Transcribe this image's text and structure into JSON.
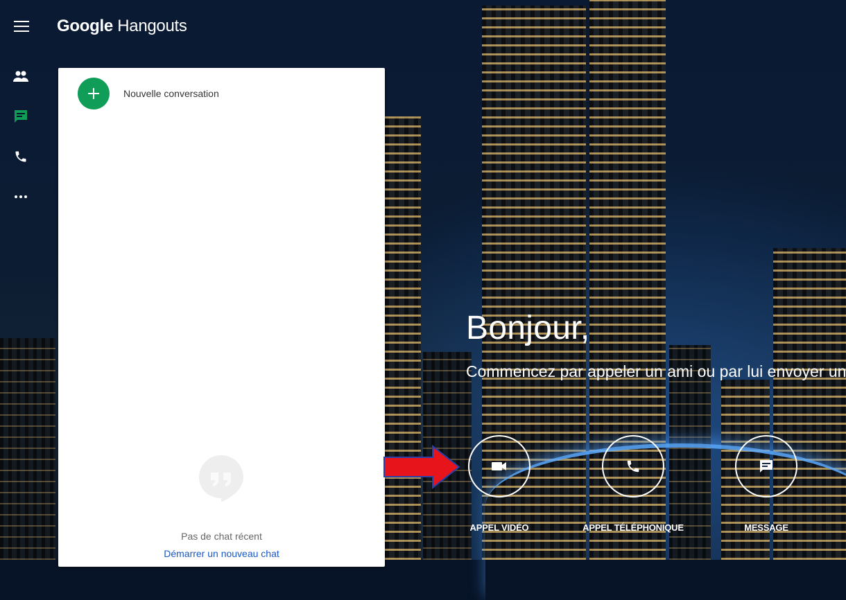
{
  "app": {
    "brand_google": "Google",
    "brand_product": "Hangouts"
  },
  "rail": {
    "items": [
      {
        "name": "contacts",
        "icon": "people-icon",
        "active": false
      },
      {
        "name": "conversations",
        "icon": "chat-icon",
        "active": true
      },
      {
        "name": "calls",
        "icon": "phone-icon",
        "active": false
      },
      {
        "name": "more",
        "icon": "more-icon",
        "active": false
      }
    ]
  },
  "panel": {
    "new_conversation_label": "Nouvelle conversation",
    "empty_text": "Pas de chat récent",
    "empty_link": "Démarrer un nouveau chat"
  },
  "welcome": {
    "greeting": "Bonjour,",
    "subtitle": "Commencez par appeler un ami ou par lui envoyer un message."
  },
  "actions": [
    {
      "label": "APPEL VIDÉO",
      "icon": "videocam-icon"
    },
    {
      "label": "APPEL TÉLÉPHONIQUE",
      "icon": "phone-icon"
    },
    {
      "label": "MESSAGE",
      "icon": "message-icon"
    }
  ],
  "colors": {
    "accent_green": "#0f9d58",
    "link_blue": "#1a57c4",
    "annotation_arrow": "#e8141b"
  }
}
